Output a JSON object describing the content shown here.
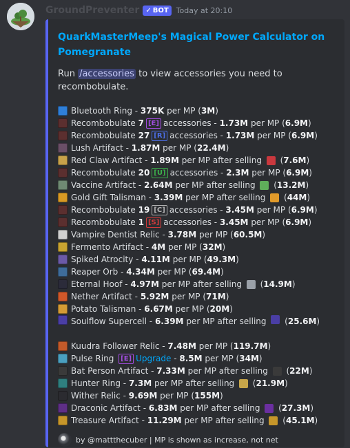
{
  "message": {
    "username": "GroundPreventer",
    "badge": "BOT",
    "badge_check": "✓",
    "timestamp": "Today at 20:10"
  },
  "embed": {
    "accent_color": "#5865f2",
    "title": "QuarkMasterMeep's Magical Power Calculator on Pomegranate",
    "description": {
      "prefix": "Run",
      "command": "/accessories",
      "suffix": "to view accessories you need to recombobulate."
    },
    "rows": [
      {
        "icon": "sapphire-ring-icon",
        "color": "#2f7fd8",
        "parts": [
          [
            "t",
            "Bluetooth Ring - "
          ],
          [
            "b",
            "375K"
          ],
          [
            "t",
            " per MP ("
          ],
          [
            "b",
            "3M"
          ],
          [
            "t",
            ")"
          ]
        ]
      },
      {
        "icon": "recomb-icon",
        "color": "#5b2f2f",
        "parts": [
          [
            "t",
            "Recombobulate "
          ],
          [
            "b",
            "7"
          ],
          [
            "r",
            "[E]",
            "#a24dde"
          ],
          [
            "t",
            "accessories - "
          ],
          [
            "b",
            "1.73M"
          ],
          [
            "t",
            " per MP ("
          ],
          [
            "b",
            "6.9M"
          ],
          [
            "t",
            ")"
          ]
        ]
      },
      {
        "icon": "recomb-icon",
        "color": "#5b2f2f",
        "parts": [
          [
            "t",
            "Recombobulate "
          ],
          [
            "b",
            "27"
          ],
          [
            "r",
            "[R]",
            "#4c6ee8"
          ],
          [
            "t",
            "accessories - "
          ],
          [
            "b",
            "1.73M"
          ],
          [
            "t",
            " per MP ("
          ],
          [
            "b",
            "6.9M"
          ],
          [
            "t",
            ")"
          ]
        ]
      },
      {
        "icon": "lush-artifact-icon",
        "color": "#6a4f67",
        "parts": [
          [
            "t",
            "Lush Artifact - "
          ],
          [
            "b",
            "1.87M"
          ],
          [
            "t",
            " per MP ("
          ],
          [
            "b",
            "22.4M"
          ],
          [
            "t",
            ")"
          ]
        ]
      },
      {
        "icon": "red-claw-icon",
        "color": "#c8a24a",
        "parts": [
          [
            "t",
            "Red Claw Artifact - "
          ],
          [
            "b",
            "1.89M"
          ],
          [
            "t",
            " per MP after selling "
          ],
          [
            "i",
            "#c9383e"
          ],
          [
            "t",
            " ("
          ],
          [
            "b",
            "7.6M"
          ],
          [
            "t",
            ")"
          ]
        ]
      },
      {
        "icon": "recomb-icon",
        "color": "#5b2f2f",
        "parts": [
          [
            "t",
            "Recombobulate "
          ],
          [
            "b",
            "20"
          ],
          [
            "r",
            "[U]",
            "#3cb14a"
          ],
          [
            "t",
            "accessories - "
          ],
          [
            "b",
            "2.3M"
          ],
          [
            "t",
            " per MP ("
          ],
          [
            "b",
            "6.9M"
          ],
          [
            "t",
            ")"
          ]
        ]
      },
      {
        "icon": "vaccine-icon",
        "color": "#6f8a73",
        "parts": [
          [
            "t",
            "Vaccine Artifact - "
          ],
          [
            "b",
            "2.64M"
          ],
          [
            "t",
            " per MP after selling "
          ],
          [
            "i",
            "#5fae5a"
          ],
          [
            "t",
            " ("
          ],
          [
            "b",
            "13.2M"
          ],
          [
            "t",
            ")"
          ]
        ]
      },
      {
        "icon": "gift-icon",
        "color": "#d99a24",
        "parts": [
          [
            "t",
            "Gold Gift Talisman - "
          ],
          [
            "b",
            "3.39M"
          ],
          [
            "t",
            " per MP after selling "
          ],
          [
            "i",
            "#e09a2a"
          ],
          [
            "t",
            " ("
          ],
          [
            "b",
            "44M"
          ],
          [
            "t",
            ")"
          ]
        ]
      },
      {
        "icon": "recomb-icon",
        "color": "#5b2f2f",
        "parts": [
          [
            "t",
            "Recombobulate "
          ],
          [
            "b",
            "19"
          ],
          [
            "r",
            "[C]",
            "#b3b3b3"
          ],
          [
            "t",
            "accessories - "
          ],
          [
            "b",
            "3.45M"
          ],
          [
            "t",
            " per MP ("
          ],
          [
            "b",
            "6.9M"
          ],
          [
            "t",
            ")"
          ]
        ]
      },
      {
        "icon": "recomb-icon",
        "color": "#5b2f2f",
        "parts": [
          [
            "t",
            "Recombobulate "
          ],
          [
            "b",
            "1"
          ],
          [
            "r",
            "[S]",
            "#d23b3b"
          ],
          [
            "t",
            "accessories - "
          ],
          [
            "b",
            "3.45M"
          ],
          [
            "t",
            " per MP ("
          ],
          [
            "b",
            "6.9M"
          ],
          [
            "t",
            ")"
          ]
        ]
      },
      {
        "icon": "vampire-icon",
        "color": "#d0d0d0",
        "parts": [
          [
            "t",
            "Vampire Dentist Relic - "
          ],
          [
            "b",
            "3.78M"
          ],
          [
            "t",
            " per MP ("
          ],
          [
            "b",
            "60.5M"
          ],
          [
            "t",
            ")"
          ]
        ]
      },
      {
        "icon": "fermento-icon",
        "color": "#c7a331",
        "parts": [
          [
            "t",
            "Fermento Artifact - "
          ],
          [
            "b",
            "4M"
          ],
          [
            "t",
            " per MP ("
          ],
          [
            "b",
            "32M"
          ],
          [
            "t",
            ")"
          ]
        ]
      },
      {
        "icon": "spiked-icon",
        "color": "#6b5aa8",
        "parts": [
          [
            "t",
            "Spiked Atrocity - "
          ],
          [
            "b",
            "4.11M"
          ],
          [
            "t",
            " per MP ("
          ],
          [
            "b",
            "49.3M"
          ],
          [
            "t",
            ")"
          ]
        ]
      },
      {
        "icon": "reaper-orb-icon",
        "color": "#3e6c9a",
        "parts": [
          [
            "t",
            "Reaper Orb - "
          ],
          [
            "b",
            "4.34M"
          ],
          [
            "t",
            " per MP ("
          ],
          [
            "b",
            "69.4M"
          ],
          [
            "t",
            ")"
          ]
        ]
      },
      {
        "icon": "eternal-hoof-icon",
        "color": "#2b2b3a",
        "parts": [
          [
            "t",
            "Eternal Hoof - "
          ],
          [
            "b",
            "4.97M"
          ],
          [
            "t",
            " per MP after selling "
          ],
          [
            "i",
            "#9aa0a8"
          ],
          [
            "t",
            " ("
          ],
          [
            "b",
            "14.9M"
          ],
          [
            "t",
            ")"
          ]
        ]
      },
      {
        "icon": "nether-icon",
        "color": "#d0582a",
        "parts": [
          [
            "t",
            "Nether Artifact - "
          ],
          [
            "b",
            "5.92M"
          ],
          [
            "t",
            " per MP ("
          ],
          [
            "b",
            "71M"
          ],
          [
            "t",
            ")"
          ]
        ]
      },
      {
        "icon": "potato-icon",
        "color": "#d49b35",
        "parts": [
          [
            "t",
            "Potato Talisman - "
          ],
          [
            "b",
            "6.67M"
          ],
          [
            "t",
            " per MP ("
          ],
          [
            "b",
            "20M"
          ],
          [
            "t",
            ")"
          ]
        ]
      },
      {
        "wrap": true,
        "icon": "soulflow-icon",
        "color": "#4a3ea5",
        "parts": [
          [
            "t",
            "Soulflow Supercell - "
          ],
          [
            "b",
            "6.39M"
          ],
          [
            "t",
            " per MP after selling "
          ],
          [
            "i",
            "#4a3ea5"
          ],
          [
            "t",
            " ("
          ],
          [
            "b",
            "25.6M"
          ],
          [
            "t",
            ")"
          ]
        ]
      },
      {
        "icon": "kuudra-icon",
        "color": "#c35a2a",
        "parts": [
          [
            "t",
            "Kuudra Follower Relic - "
          ],
          [
            "b",
            "7.48M"
          ],
          [
            "t",
            " per MP ("
          ],
          [
            "b",
            "119.7M"
          ],
          [
            "t",
            ")"
          ]
        ]
      },
      {
        "icon": "pulse-ring-icon",
        "color": "#4aa0c0",
        "parts": [
          [
            "t",
            "Pulse Ring "
          ],
          [
            "r",
            "[E]",
            "#a24dde"
          ],
          [
            "l",
            "Upgrade"
          ],
          [
            "t",
            " - "
          ],
          [
            "b",
            "8.5M"
          ],
          [
            "t",
            " per MP ("
          ],
          [
            "b",
            "34M"
          ],
          [
            "t",
            ")"
          ]
        ]
      },
      {
        "icon": "bat-person-icon",
        "color": "#3a3a3a",
        "parts": [
          [
            "t",
            "Bat Person Artifact - "
          ],
          [
            "b",
            "7.33M"
          ],
          [
            "t",
            " per MP after selling "
          ],
          [
            "i",
            "#3a3a3a"
          ],
          [
            "t",
            " ("
          ],
          [
            "b",
            "22M"
          ],
          [
            "t",
            ")"
          ]
        ]
      },
      {
        "icon": "hunter-ring-icon",
        "color": "#2f7f7f",
        "parts": [
          [
            "t",
            "Hunter Ring - "
          ],
          [
            "b",
            "7.3M"
          ],
          [
            "t",
            " per MP after selling "
          ],
          [
            "i",
            "#c7a64a"
          ],
          [
            "t",
            " ("
          ],
          [
            "b",
            "21.9M"
          ],
          [
            "t",
            ")"
          ]
        ]
      },
      {
        "icon": "wither-icon",
        "color": "#2b2b30",
        "parts": [
          [
            "t",
            "Wither Relic - "
          ],
          [
            "b",
            "9.69M"
          ],
          [
            "t",
            " per MP ("
          ],
          [
            "b",
            "155M"
          ],
          [
            "t",
            ")"
          ]
        ]
      },
      {
        "icon": "draconic-icon",
        "color": "#5e2f86",
        "parts": [
          [
            "t",
            "Draconic Artifact - "
          ],
          [
            "b",
            "6.83M"
          ],
          [
            "t",
            " per MP after selling "
          ],
          [
            "i",
            "#6b2fa0"
          ],
          [
            "t",
            " ("
          ],
          [
            "b",
            "27.3M"
          ],
          [
            "t",
            ")"
          ]
        ]
      },
      {
        "icon": "treasure-icon",
        "color": "#c6962a",
        "parts": [
          [
            "t",
            "Treasure Artifact - "
          ],
          [
            "b",
            "11.29M"
          ],
          [
            "t",
            " per MP after selling "
          ],
          [
            "i",
            "#c6962a"
          ],
          [
            "t",
            " ("
          ],
          [
            "b",
            "45.1M"
          ],
          [
            "t",
            ")"
          ]
        ]
      }
    ],
    "footer": "by @mattthecuber | MP is shown as increase, not net"
  }
}
